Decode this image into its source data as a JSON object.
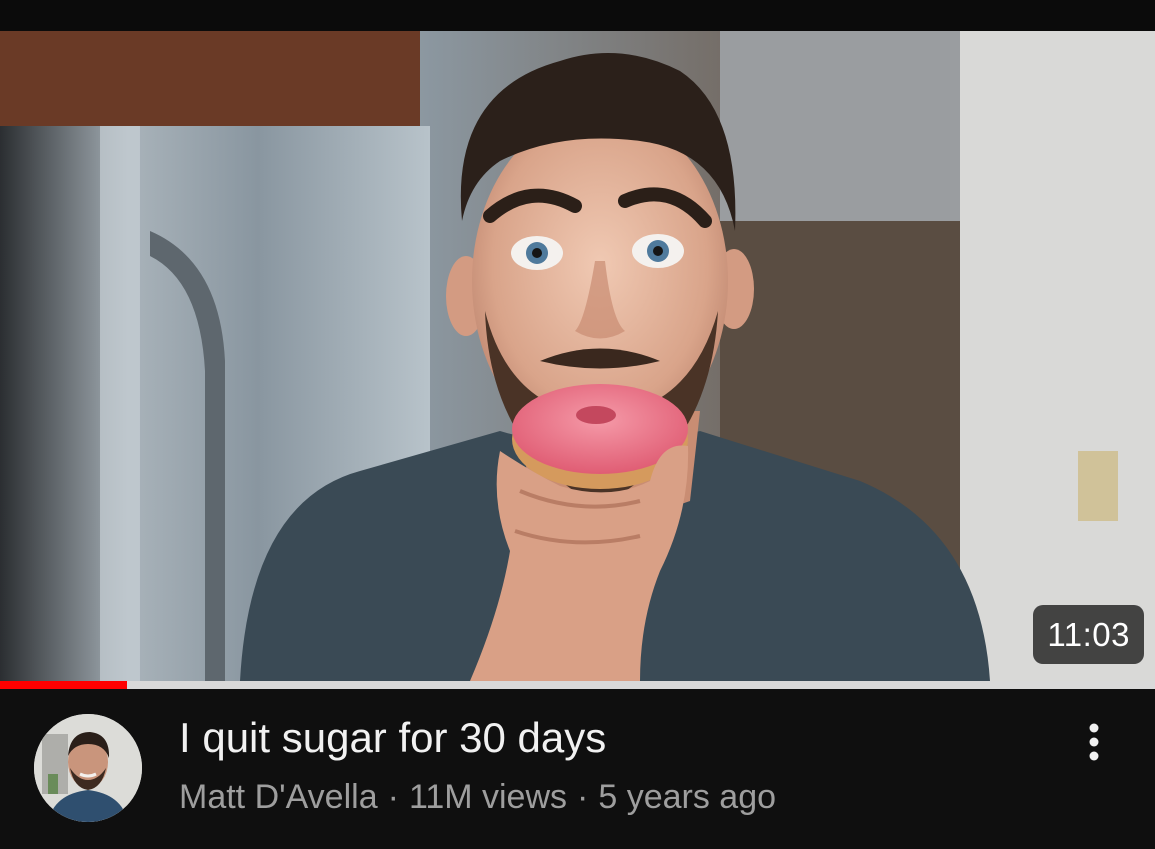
{
  "video": {
    "title": "I quit sugar for 30 days",
    "duration": "11:03",
    "progress_fraction": 0.11
  },
  "channel": {
    "name": "Matt D'Avella",
    "views": "11M views",
    "age": "5 years ago",
    "separator": "·"
  },
  "icons": {
    "more": "more-vert-icon"
  },
  "colors": {
    "background": "#0f0f0f",
    "progress": "#ff0000",
    "progress_track": "#d9d9d9",
    "title_text": "#f1f1f1",
    "meta_text": "#9e9e9e"
  }
}
